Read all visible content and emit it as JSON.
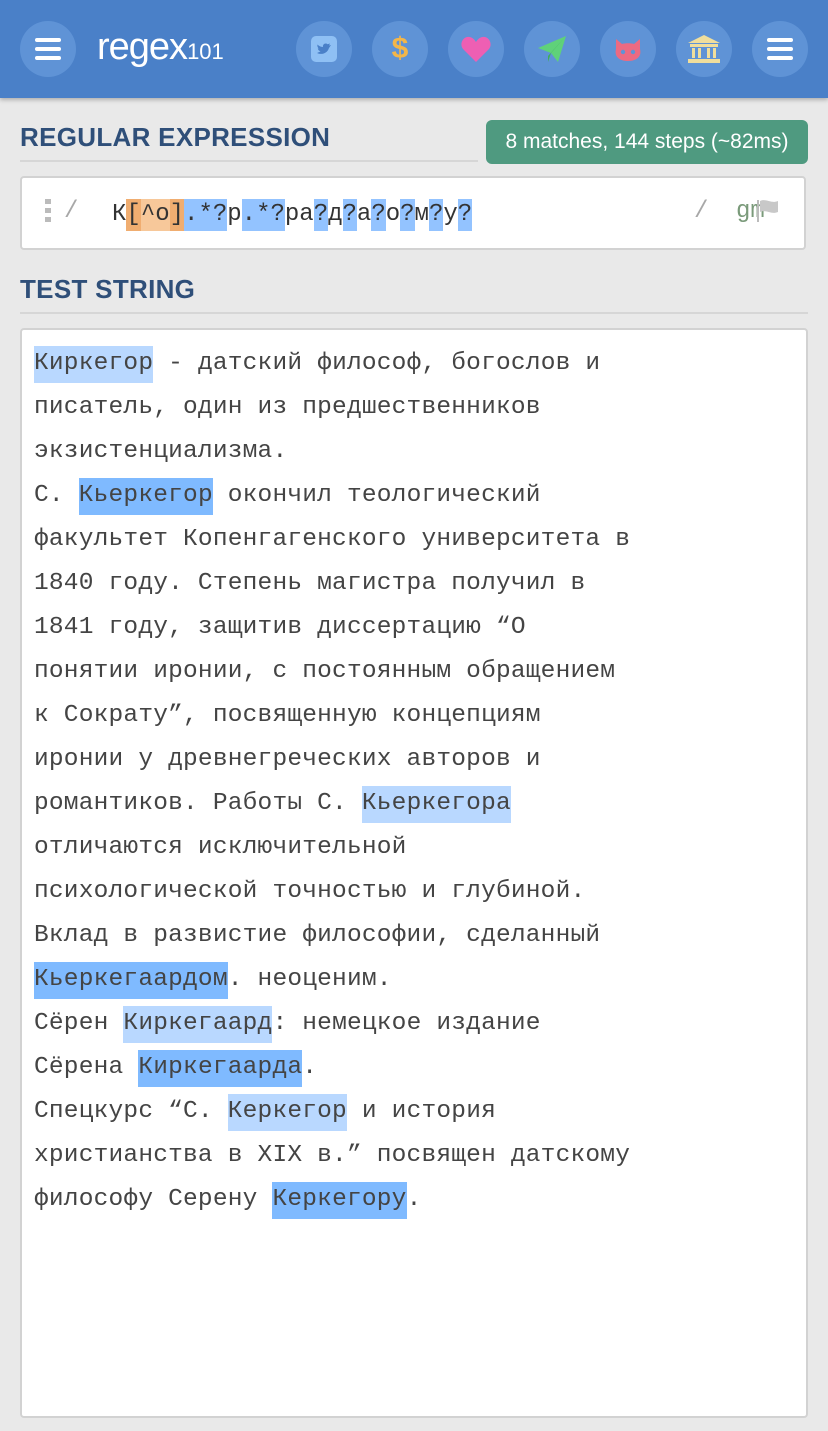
{
  "header": {
    "logo_main": "regex",
    "logo_sub": "101",
    "icons": [
      "menu-icon",
      "twitter-icon",
      "dollar-icon",
      "heart-icon",
      "paper-plane-icon",
      "github-icon",
      "bank-icon",
      "menu-icon"
    ]
  },
  "regex_section": {
    "title": "REGULAR EXPRESSION",
    "match_info": "8 matches, 144 steps (~82ms)",
    "delimiter_open": "/",
    "tokens": [
      "К",
      "[",
      "^",
      "о",
      "]",
      ".",
      "*",
      "?",
      "р",
      ".",
      "*",
      "?",
      "р",
      "а",
      "?",
      "д",
      "?",
      "а",
      "?",
      "о",
      "?",
      "м",
      "?",
      "у",
      "?"
    ],
    "delimiter_close": "/",
    "flags": "gm"
  },
  "test_section": {
    "title": "TEST STRING",
    "lines": [
      [
        {
          "t": "Киркегор",
          "m": 1
        },
        {
          "t": " - датский философ, богослов и"
        }
      ],
      [
        {
          "t": "писатель, один из предшественников"
        }
      ],
      [
        {
          "t": "экзистенциализма."
        }
      ],
      [
        {
          "t": "С. "
        },
        {
          "t": "Кьеркегор",
          "m": 2
        },
        {
          "t": " окончил теологический"
        }
      ],
      [
        {
          "t": "факультет Копенгагенского университета в"
        }
      ],
      [
        {
          "t": "1840 году. Степень магистра получил в"
        }
      ],
      [
        {
          "t": "1841 году, защитив диссертацию “О"
        }
      ],
      [
        {
          "t": "понятии иронии, с постоянным обращением"
        }
      ],
      [
        {
          "t": "к Сократу”, посвященную концепциям"
        }
      ],
      [
        {
          "t": "иронии у древнегреческих авторов и"
        }
      ],
      [
        {
          "t": "романтиков. Работы С. "
        },
        {
          "t": "Кьеркегора",
          "m": 1
        }
      ],
      [
        {
          "t": "отличаются исключительной"
        }
      ],
      [
        {
          "t": "психологической точностью и глубиной."
        }
      ],
      [
        {
          "t": "Вклад в развистие философии, сделанный"
        }
      ],
      [
        {
          "t": "Кьеркегаардом",
          "m": 2
        },
        {
          "t": ". неоценим."
        }
      ],
      [
        {
          "t": "Сёрен "
        },
        {
          "t": "Киркегаард",
          "m": 1
        },
        {
          "t": ": немецкое издание"
        }
      ],
      [
        {
          "t": "Сёрена "
        },
        {
          "t": "Киркегаарда",
          "m": 2
        },
        {
          "t": "."
        }
      ],
      [
        {
          "t": "Спецкурс “С. "
        },
        {
          "t": "Керкегор",
          "m": 1
        },
        {
          "t": " и история"
        }
      ],
      [
        {
          "t": "христианства в XIX в.” посвящен датскому"
        }
      ],
      [
        {
          "t": "философу Серену "
        },
        {
          "t": "Керкегору",
          "m": 2
        },
        {
          "t": "."
        }
      ]
    ]
  }
}
